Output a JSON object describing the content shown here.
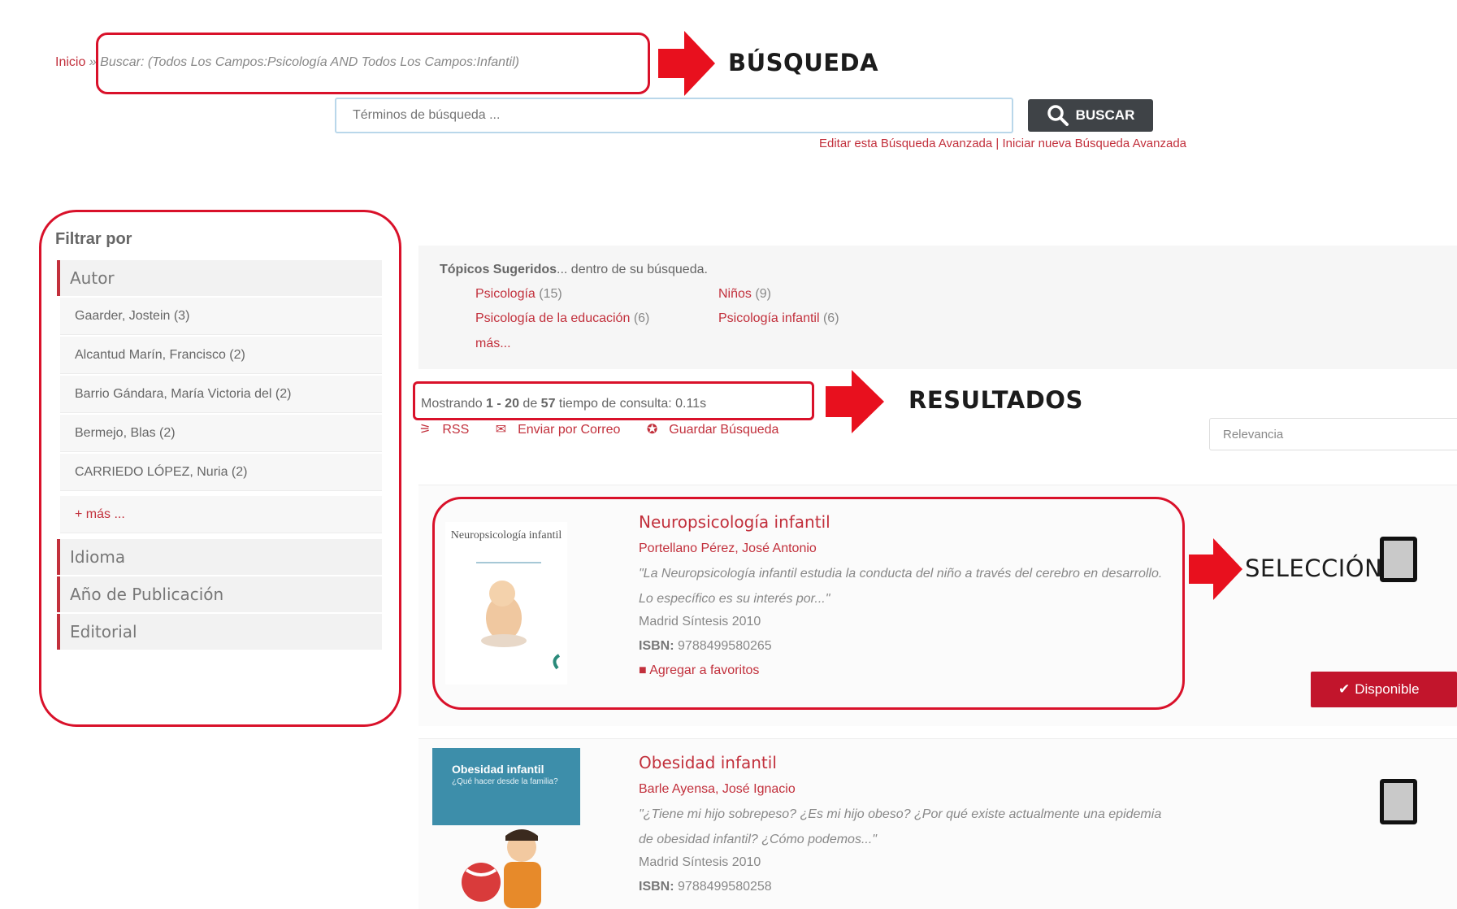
{
  "breadcrumb": {
    "home": "Inicio",
    "separator": " » ",
    "query": "Buscar: (Todos Los Campos:Psicología AND Todos Los Campos:Infantil)"
  },
  "search": {
    "placeholder": "Términos de búsqueda ...",
    "button_label": "BUSCAR",
    "edit_advanced": "Editar esta Búsqueda Avanzada",
    "links_separator": " | ",
    "new_advanced": "Iniciar nueva Búsqueda Avanzada"
  },
  "annotations": {
    "search": "BÚSQUEDA",
    "results": "RESULTADOS",
    "selection": "SELECCIÓN"
  },
  "sidebar": {
    "title": "Filtrar por",
    "author_facet": "Autor",
    "authors": [
      "Gaarder, Jostein (3)",
      "Alcantud Marín, Francisco (2)",
      "Barrio Gándara, María Victoria del (2)",
      "Bermejo, Blas (2)",
      "CARRIEDO LÓPEZ, Nuria (2)"
    ],
    "more": "+ más ...",
    "facets": [
      "Idioma",
      "Año de Publicación",
      "Editorial"
    ]
  },
  "topics": {
    "label": "Tópicos Sugeridos",
    "suffix": "... dentro de su búsqueda.",
    "items": [
      {
        "name": "Psicología",
        "count": "(15)"
      },
      {
        "name": "Niños",
        "count": "(9)"
      },
      {
        "name": "Psicología de la educación",
        "count": "(6)"
      },
      {
        "name": "Psicología infantil",
        "count": "(6)"
      }
    ],
    "more": "más..."
  },
  "results": {
    "prefix": "Mostrando",
    "range": "1 - 20",
    "of": "de",
    "total": "57",
    "time": "tiempo de consulta: 0.11s",
    "rss": "RSS",
    "email": "Enviar por Correo",
    "save": "Guardar Búsqueda",
    "sort": "Relevancia"
  },
  "records": [
    {
      "title": "Neuropsicología infantil",
      "author": "Portellano Pérez, José Antonio",
      "description": "\"La Neuropsicología infantil estudia la conducta del niño a través del cerebro en desarrollo. Lo específico es su interés por...\"",
      "publisher": "Madrid Síntesis 2010",
      "isbn_label": "ISBN:",
      "isbn": "9788499580265",
      "favorite": "Agregar a favoritos",
      "cover_title": "Neuropsicología infantil",
      "status": "Disponible"
    },
    {
      "title": "Obesidad infantil",
      "author": "Barle Ayensa, José Ignacio",
      "description": "\"¿Tiene mi hijo sobrepeso? ¿Es mi hijo obeso? ¿Por qué existe actualmente una epidemia de obesidad infantil? ¿Cómo podemos...\"",
      "publisher": "Madrid Síntesis 2010",
      "isbn_label": "ISBN:",
      "isbn": "9788499580258",
      "cover_title": "Obesidad infantil",
      "cover_subtitle": "¿Qué hacer desde la familia?"
    }
  ],
  "colors": {
    "accent": "#c2303c",
    "annotation": "#d9112a",
    "search_button": "#3f4347",
    "available": "#c2152c"
  }
}
